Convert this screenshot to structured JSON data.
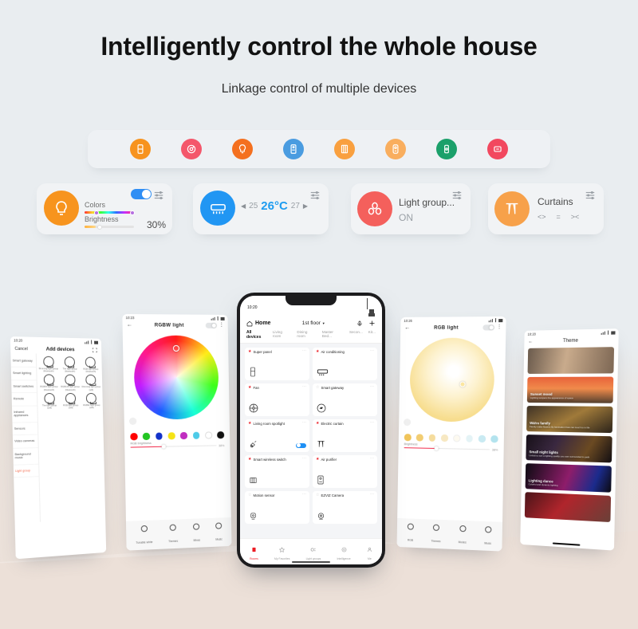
{
  "hero": {
    "title": "Intelligently control the whole house",
    "subtitle": "Linkage control of multiple devices"
  },
  "icon_strip": {
    "items": [
      {
        "name": "switch-panel-icon",
        "color": "#f7931e"
      },
      {
        "name": "thermostat-dial-icon",
        "color": "#f4576b"
      },
      {
        "name": "light-bulb-icon",
        "color": "#f4701f"
      },
      {
        "name": "smart-socket-icon",
        "color": "#4a9ce0"
      },
      {
        "name": "curtain-icon",
        "color": "#f9a03f"
      },
      {
        "name": "sensor-icon",
        "color": "#f9ae5e"
      },
      {
        "name": "gateway-icon",
        "color": "#1ba06a"
      },
      {
        "name": "remote-control-icon",
        "color": "#f2485f"
      }
    ]
  },
  "control_cards": {
    "light": {
      "icon": "light-bulb-icon",
      "icon_color": "#f7941e",
      "colors_label": "Colors",
      "brightness_label": "Brightness",
      "brightness_value": "30%",
      "toggle_on": true,
      "settings_icon": "sliders-icon"
    },
    "air_conditioner": {
      "icon": "air-conditioner-icon",
      "icon_color": "#2196f3",
      "temp_down": "25",
      "temp_current": "26°C",
      "temp_up": "27",
      "settings_icon": "sliders-icon"
    },
    "light_group": {
      "icon": "light-group-icon",
      "icon_color": "#f4605c",
      "title": "Light group...",
      "status": "ON",
      "settings_icon": "sliders-icon"
    },
    "curtains": {
      "icon": "curtain-icon",
      "icon_color": "#f7a14a",
      "title": "Curtains",
      "controls": [
        "<>",
        "=",
        "><"
      ],
      "settings_icon": "sliders-icon"
    }
  },
  "phone_add_devices": {
    "status_time": "10:20",
    "cancel_label": "Cancel",
    "title": "Add devices",
    "scan_icon": "scan-icon",
    "categories": [
      {
        "label": "Smart gateway",
        "active": false
      },
      {
        "label": "Smart lighting",
        "active": false
      },
      {
        "label": "Smart switches",
        "active": false
      },
      {
        "label": "Remote",
        "active": false
      },
      {
        "label": "Infrared appliances",
        "active": false
      },
      {
        "label": "Sensors",
        "active": false
      },
      {
        "label": "Video cameras",
        "active": false
      },
      {
        "label": "Background music",
        "active": false
      },
      {
        "label": "Light group",
        "active": true
      }
    ],
    "devices": [
      {
        "label": "Dimming light group (bluetooth)"
      },
      {
        "label": "The light group (bluetooth)"
      },
      {
        "label": "RGB  light group (bluetooth)"
      },
      {
        "label": "RGBW light group (bluetooth)"
      },
      {
        "label": "RGBCW light group (bluetooth)"
      },
      {
        "label": "Dimming light group (wifi)"
      },
      {
        "label": "The light group (wifi)"
      },
      {
        "label": "RGB light group (wifi)"
      },
      {
        "label": "RGBW light group (wifi)"
      }
    ]
  },
  "phone_rgbw": {
    "status_time": "10:23",
    "back_icon": "back-arrow-icon",
    "title": "RGBW  light",
    "toggle_on": false,
    "more_icon": "more-vertical-icon",
    "swatches": [
      "#ff0000",
      "#22c522",
      "#1332c9",
      "#f5e315",
      "#c02ec0",
      "#4ecbe8",
      "#ffffff",
      "#111111"
    ],
    "brightness_label": "RGB brightness",
    "brightness_value": "38%",
    "tabs": [
      {
        "label": "Tunable white",
        "icon": "bulb-icon"
      },
      {
        "label": "Themes",
        "icon": "themes-icon"
      },
      {
        "label": "Mixes",
        "icon": "mixes-icon"
      },
      {
        "label": "Music",
        "icon": "music-icon"
      }
    ]
  },
  "phone_main": {
    "status_time": "10:20",
    "home_label": "Home",
    "home_icon": "home-icon",
    "floor_label": "1st floor",
    "mic_icon": "mic-icon",
    "add_icon": "plus-icon",
    "tabs": [
      {
        "label": "All devices",
        "active": true
      },
      {
        "label": "Living room",
        "active": false
      },
      {
        "label": "Dining room",
        "active": false
      },
      {
        "label": "Master Bed...",
        "active": false
      },
      {
        "label": "Secon...",
        "active": false
      },
      {
        "label": "Kit...",
        "active": false
      }
    ],
    "devices": [
      {
        "name": "Super panel",
        "fav": true,
        "icon": "panel-icon",
        "toggle": null
      },
      {
        "name": "Air conditioning",
        "fav": true,
        "icon": "ac-icon",
        "toggle": null
      },
      {
        "name": "Fan",
        "fav": true,
        "icon": "fan-icon",
        "toggle": null
      },
      {
        "name": "Smart gateway",
        "fav": false,
        "icon": "gateway-icon",
        "toggle": null
      },
      {
        "name": "Living room spotlight",
        "fav": true,
        "icon": "spotlight-icon",
        "toggle": true
      },
      {
        "name": "Electric curtain",
        "fav": true,
        "icon": "curtain-icon",
        "toggle": null
      },
      {
        "name": "Smart wireless switch",
        "fav": true,
        "icon": "switch-icon",
        "toggle": null
      },
      {
        "name": "Air purifier",
        "fav": true,
        "icon": "purifier-icon",
        "toggle": null
      },
      {
        "name": "Motion sensor",
        "fav": false,
        "icon": "motion-sensor-icon",
        "toggle": null
      },
      {
        "name": "EZVIZ Camera",
        "fav": false,
        "icon": "camera-icon",
        "toggle": null
      }
    ],
    "bottom_nav": [
      {
        "label": "Rooms",
        "icon": "rooms-icon",
        "active": true
      },
      {
        "label": "My Favorites",
        "icon": "star-icon",
        "active": false
      },
      {
        "label": "Light groups",
        "icon": "light-groups-icon",
        "active": false
      },
      {
        "label": "Intelligence",
        "icon": "intelligence-icon",
        "active": false
      },
      {
        "label": "Me",
        "icon": "profile-icon",
        "active": false
      }
    ]
  },
  "phone_warm": {
    "status_time": "10:26",
    "back_icon": "back-arrow-icon",
    "title": "RGB        light",
    "toggle_on": false,
    "more_icon": "more-vertical-icon",
    "swatches": [
      "#f0c45a",
      "#f2cd72",
      "#f5dc9d",
      "#f7e8c2",
      "#fdfaf0",
      "#e4f3f6",
      "#c9eaf2",
      "#b3e3ee"
    ],
    "brightness_label": "Brightness",
    "brightness_value": "38%",
    "tabs": [
      {
        "label": "RGB",
        "icon": "rgb-icon"
      },
      {
        "label": "Themes",
        "icon": "themes-icon"
      },
      {
        "label": "Modes",
        "icon": "modes-icon"
      },
      {
        "label": "Music",
        "icon": "music-icon"
      }
    ]
  },
  "phone_theme": {
    "status_time": "10:20",
    "back_icon": "back-arrow-icon",
    "title": "Theme",
    "cards": [
      {
        "title": "",
        "subtitle": "",
        "grad": "linear-gradient(100deg,#6b5b4d,#c9ab8c 45%,#7d6754)"
      },
      {
        "title": "Sunset mood",
        "subtitle": "Lighting tempers the appearance of space",
        "grad": "linear-gradient(180deg,#e8623a,#f08a4b 45%,#53402f)"
      },
      {
        "title": "Warm family",
        "subtitle": "Family make flowers lily lamination how can touch to in life",
        "grad": "linear-gradient(150deg,#3e3226,#a07a3a 50%,#2b231a)"
      },
      {
        "title": "Small night lights",
        "subtitle": "Unfold to sort a lighting quality you own surrounded in path",
        "grad": "linear-gradient(120deg,#171018,#3a2840 35%,#6b4a22 70%,#120e12)"
      },
      {
        "title": "Lighting dance",
        "subtitle": "Colorful and dynamic lighting",
        "grad": "linear-gradient(110deg,#0d0b12,#8e1d6a 50%,#1b2b8c 80%,#0c0a10)"
      },
      {
        "title": "",
        "subtitle": "",
        "grad": "linear-gradient(130deg,#4a1418,#b0252c 45%,#6a4038)"
      }
    ]
  }
}
